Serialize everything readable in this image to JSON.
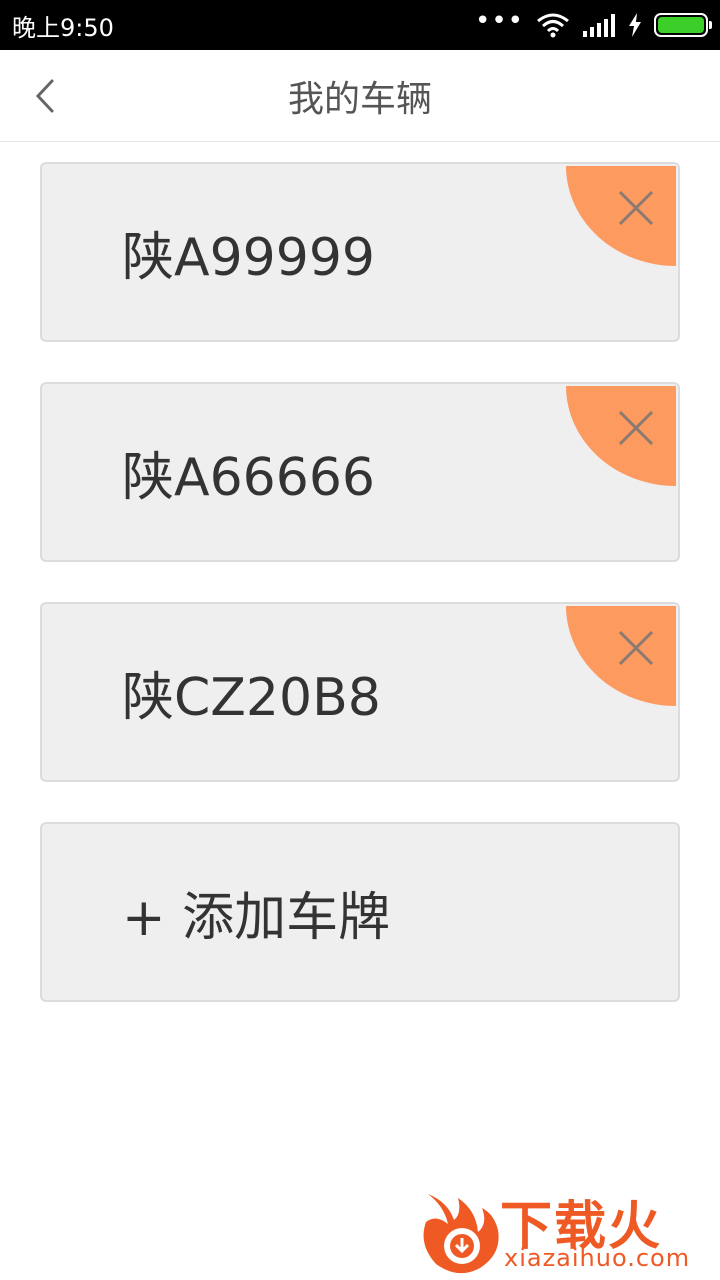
{
  "status_bar": {
    "time": "晚上9:50",
    "dots": "•••"
  },
  "header": {
    "title": "我的车辆"
  },
  "vehicles": [
    {
      "plate": "陕A99999"
    },
    {
      "plate": "陕A66666"
    },
    {
      "plate": "陕CZ20B8"
    }
  ],
  "add_plate_label": "+ 添加车牌",
  "watermark": {
    "brand": "下载火",
    "url": "xiazaihuo.com"
  },
  "colors": {
    "accent": "#fd9a5f",
    "card_bg": "#efefef",
    "battery": "#3ccf2a",
    "watermark": "#ef5a24"
  },
  "icons": [
    "back-arrow-icon",
    "wifi-icon",
    "signal-icon",
    "charging-icon",
    "battery-icon",
    "close-icon"
  ]
}
